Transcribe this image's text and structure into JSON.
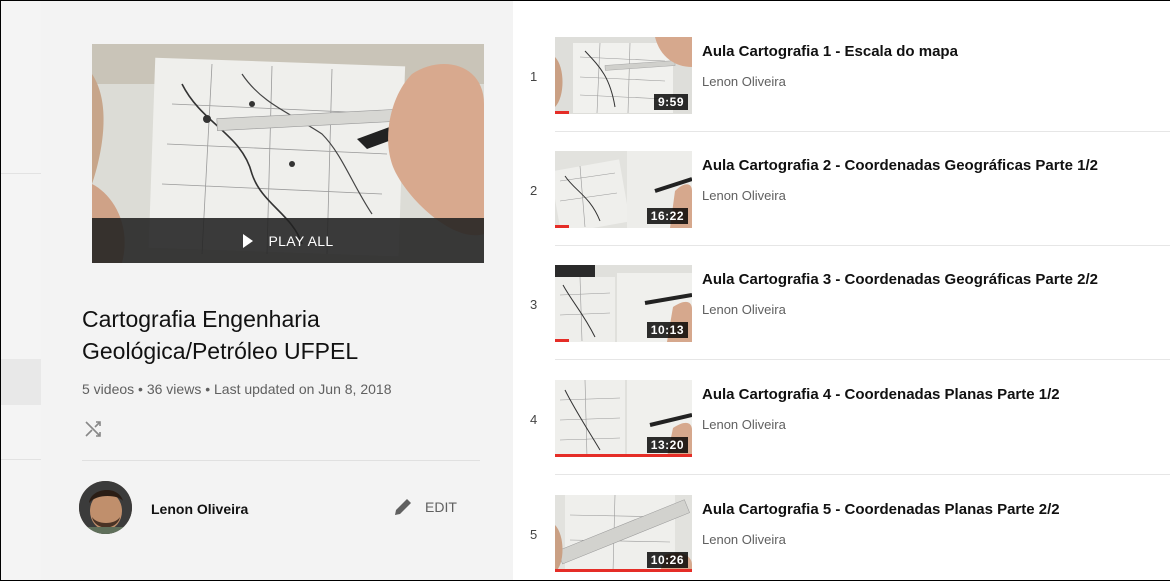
{
  "playlist": {
    "play_all_label": "PLAY ALL",
    "title": "Cartografia Engenharia Geológica/Petróleo UFPEL",
    "videos_count": "5 videos",
    "views": "36 views",
    "last_updated": "Last updated on Jun 8, 2018",
    "stats_separator": "•",
    "owner_name": "Lenon Oliveira",
    "edit_label": "EDIT"
  },
  "videos": [
    {
      "index": "1",
      "title": "Aula Cartografia 1 - Escala do mapa",
      "channel": "Lenon Oliveira",
      "duration": "9:59",
      "watched_fraction": 0.1
    },
    {
      "index": "2",
      "title": "Aula Cartografia 2 - Coordenadas Geográficas Parte 1/2",
      "channel": "Lenon Oliveira",
      "duration": "16:22",
      "watched_fraction": 0.1
    },
    {
      "index": "3",
      "title": "Aula Cartografia 3 - Coordenadas Geográficas Parte 2/2",
      "channel": "Lenon Oliveira",
      "duration": "10:13",
      "watched_fraction": 0.1
    },
    {
      "index": "4",
      "title": "Aula Cartografia 4 - Coordenadas Planas Parte 1/2",
      "channel": "Lenon Oliveira",
      "duration": "13:20",
      "watched_fraction": 1.0
    },
    {
      "index": "5",
      "title": "Aula Cartografia 5 - Coordenadas Planas Parte 2/2",
      "channel": "Lenon Oliveira",
      "duration": "10:26",
      "watched_fraction": 1.0
    }
  ],
  "colors": {
    "progress": "#e52d27",
    "sidebar_bg": "#f3f3f3"
  },
  "icons": {
    "play": "play-icon",
    "shuffle": "shuffle-icon",
    "edit": "pencil-icon"
  }
}
